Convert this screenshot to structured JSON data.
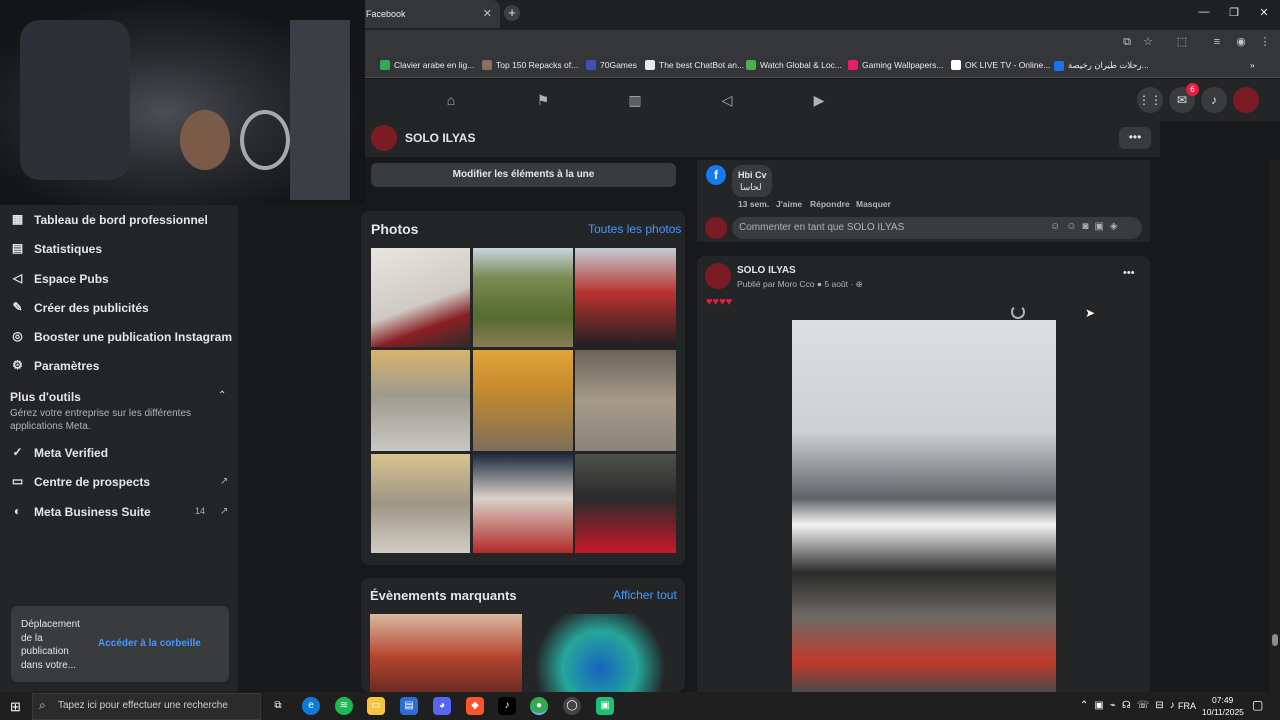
{
  "browser": {
    "tab_title": "Facebook",
    "bookmarks": [
      "Clavier arabe en lig...",
      "Top 150 Repacks of...",
      "70Games",
      "The best ChatBot an...",
      "Watch Global & Loc...",
      "Gaming Wallpapers...",
      "OK LIVE TV - Online...",
      "رحلات طيران رخيصة..."
    ]
  },
  "fb": {
    "messenger_badge": "6"
  },
  "page_header": {
    "name": "SOLO ILYAS"
  },
  "sidebar": {
    "items": [
      {
        "label": "Tableau de bord professionnel"
      },
      {
        "label": "Statistiques"
      },
      {
        "label": "Espace Pubs"
      },
      {
        "label": "Créer des publicités"
      },
      {
        "label": "Booster une publication Instagram"
      },
      {
        "label": "Paramètres"
      }
    ],
    "tools_title": "Plus d'outils",
    "tools_desc": "Gérez votre entreprise sur les différentes applications Meta.",
    "tools": [
      {
        "label": "Meta Verified"
      },
      {
        "label": "Centre de prospects"
      },
      {
        "label": "Meta Business Suite",
        "badge": "14"
      }
    ],
    "toast_text": "Déplacement de la publication dans votre...",
    "toast_link": "Accéder à la corbeille"
  },
  "featured": {
    "button": "Modifier les éléments à la une"
  },
  "photos": {
    "title": "Photos",
    "link": "Toutes les photos"
  },
  "events": {
    "title": "Évènements marquants",
    "link": "Afficher tout"
  },
  "comment": {
    "author": "Hbi Cv",
    "text": "لحاسا",
    "time": "13 sem.",
    "like": "J'aime",
    "reply": "Répondre",
    "hide": "Masquer",
    "input_placeholder": "Commenter en tant que SOLO ILYAS"
  },
  "post": {
    "author": "SOLO ILYAS",
    "meta_prefix": "Publié par Moro Cco",
    "date": "5 août",
    "text": "♥♥♥♥"
  },
  "taskbar": {
    "search_placeholder": "Tapez ici pour effectuer une recherche",
    "lang": "FRA",
    "time": "07:49",
    "date": "10/11/2025"
  }
}
